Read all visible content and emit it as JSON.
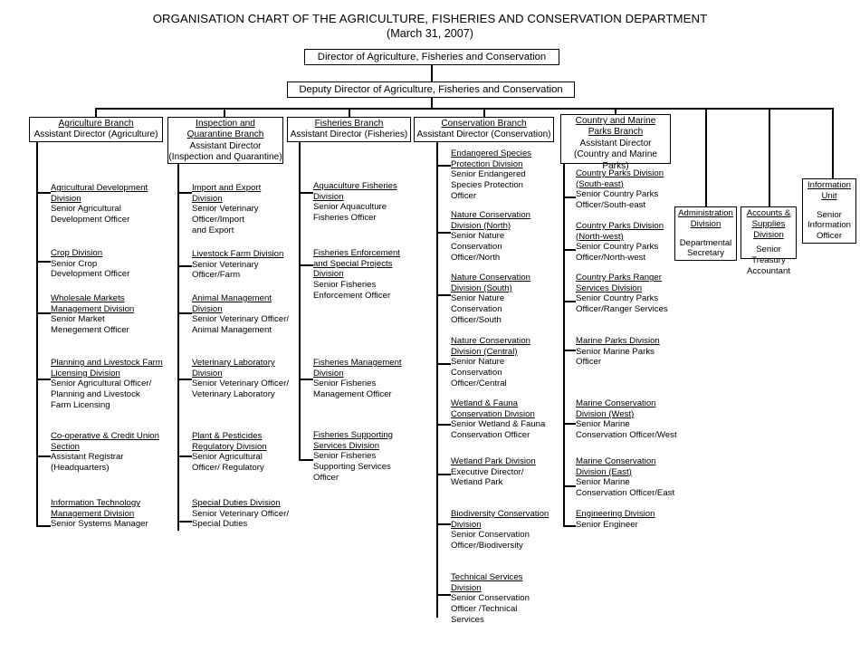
{
  "header": {
    "title": "ORGANISATION CHART OF THE AGRICULTURE, FISHERIES AND CONSERVATION DEPARTMENT",
    "date": "(March 31,  2007)"
  },
  "top": {
    "director": "Director of Agriculture, Fisheries and Conservation",
    "deputy_director": "Deputy Director of Agriculture, Fisheries and Conservation"
  },
  "branches": [
    {
      "id": "agriculture",
      "box": {
        "title_lines": [
          "Agriculture Branch"
        ],
        "role_lines": [
          "Assistant Director (Agriculture)"
        ]
      },
      "units": [
        {
          "head": [
            "Agricultural Development",
            "Division"
          ],
          "role": [
            "Senior Agricultural",
            "Development Officer"
          ]
        },
        {
          "head": [
            "Crop Division"
          ],
          "role": [
            "Senior Crop",
            "Development Officer"
          ]
        },
        {
          "head": [
            "Wholesale Markets",
            "Management Division"
          ],
          "role": [
            "Senior Market",
            "Menegement Officer"
          ]
        },
        {
          "head": [
            "Planning and Livestock Farm",
            "Licensing Division"
          ],
          "role": [
            "Senior Agricultural Officer/",
            "Planning and Livestock",
            "Farm Licensing"
          ]
        },
        {
          "head": [
            "Co-operative & Credit Union",
            "Section"
          ],
          "role": [
            "Assistant Registrar",
            "(Headquarters)"
          ]
        },
        {
          "head": [
            "Information Technology ",
            "Management Division"
          ],
          "role": [
            "Senior Systems Manager"
          ]
        }
      ]
    },
    {
      "id": "inspection",
      "box": {
        "title_lines": [
          "Inspection and",
          "Quarantine Branch"
        ],
        "role_lines": [
          "Assistant Director",
          "(Inspection and Quarantine)"
        ]
      },
      "units": [
        {
          "head": [
            "Import and Export ",
            "Division"
          ],
          "role": [
            "Senior Veterinary",
            "Officer/Import",
            "and Export"
          ]
        },
        {
          "head": [
            "Livestock Farm Division"
          ],
          "role": [
            "Senior Veterinary",
            "Officer/Farm"
          ]
        },
        {
          "head": [
            "Animal Management ",
            "Division"
          ],
          "role": [
            "Senior Veterinary Officer/",
            "Animal Management"
          ]
        },
        {
          "head": [
            "Veterinary Laboratory",
            "Division"
          ],
          "role": [
            "Senior Veterinary Officer/",
            "Veterinary Laboratory"
          ]
        },
        {
          "head": [
            "Plant & Pesticides",
            "Regulatory Division"
          ],
          "role": [
            "Senior Agricultural",
            "Officer/ Regulatory"
          ]
        },
        {
          "head": [
            "Special Duties Division"
          ],
          "role": [
            "Senior Veterinary Officer/",
            "Special Duties"
          ]
        }
      ]
    },
    {
      "id": "fisheries",
      "box": {
        "title_lines": [
          "Fisheries Branch"
        ],
        "role_lines": [
          "Assistant Director  (Fisheries)"
        ]
      },
      "units": [
        {
          "head": [
            "Aquaculture Fisheries",
            "Division"
          ],
          "role": [
            "Senior Aquaculture",
            "Fisheries Officer"
          ]
        },
        {
          "head": [
            "Fisheries Enforcement",
            "and Special Projects",
            "Division"
          ],
          "role": [
            "Senior Fisheries",
            "Enforcement Officer"
          ]
        },
        {
          "head": [
            "Fisheries Management",
            "Division"
          ],
          "role": [
            "Senior Fisheries",
            "Management Officer"
          ]
        },
        {
          "head": [
            "Fisheries Supporting ",
            "Services Division"
          ],
          "role": [
            "Senior Fisheries",
            "Supporting Services",
            "Officer"
          ]
        }
      ]
    },
    {
      "id": "conservation",
      "box": {
        "title_lines": [
          "Conservation Branch"
        ],
        "role_lines": [
          "Assistant Director (Conservation)"
        ]
      },
      "units": [
        {
          "head": [
            "Endangered Species",
            "Protection Division"
          ],
          "role": [
            "Senior Endangered",
            "Species Protection",
            "Officer"
          ]
        },
        {
          "head": [
            "Nature Conservation",
            "Division (North)"
          ],
          "role": [
            "Senior Nature",
            "Conservation",
            "Officer/North"
          ]
        },
        {
          "head": [
            "Nature Conservation",
            "Division (South)"
          ],
          "role": [
            "Senior Nature",
            "Conservation",
            "Officer/South"
          ]
        },
        {
          "head": [
            "Nature Conservation",
            "Division (Central)"
          ],
          "role": [
            "Senior Nature",
            "Conservation",
            "Officer/Central"
          ]
        },
        {
          "head": [
            "Wetland & Fauna",
            "Conservation Division"
          ],
          "role": [
            "Senior Wetland & Fauna",
            "Conservation Officer"
          ]
        },
        {
          "head": [
            "Wetland Park Division"
          ],
          "role": [
            "Executive Director/",
            "Wetland Park"
          ]
        },
        {
          "head": [
            "Biodiversity Conservation",
            "Division"
          ],
          "role": [
            "Senior Conservation",
            "Officer/Biodiversity"
          ]
        },
        {
          "head": [
            "Technical Services",
            "Division"
          ],
          "role": [
            "Senior Conservation",
            "Officer /Technical",
            "Services"
          ]
        }
      ]
    },
    {
      "id": "country-marine-parks",
      "box": {
        "title_lines": [
          "Country and Marine",
          "Parks Branch"
        ],
        "role_lines": [
          "Assistant Director",
          "(Country and Marine Parks)"
        ]
      },
      "units": [
        {
          "head": [
            "Country Parks Division",
            "(South-east)"
          ],
          "role": [
            "Senior Country Parks",
            "Officer/South-east"
          ]
        },
        {
          "head": [
            "Country Parks Division",
            "(North-west)"
          ],
          "role": [
            "Senior Country Parks",
            "Officer/North-west"
          ]
        },
        {
          "head": [
            "Country Parks Ranger",
            "Services Division"
          ],
          "role": [
            "Senior Country Parks",
            "Officer/Ranger Services"
          ]
        },
        {
          "head": [
            "Marine Parks Division"
          ],
          "role": [
            "Senior Marine Parks",
            "Officer"
          ]
        },
        {
          "head": [
            "Marine Conservation",
            "Division (West)"
          ],
          "role": [
            "Senior Marine",
            "Conservation Officer/West"
          ]
        },
        {
          "head": [
            "Marine Conservation",
            "Division (East)"
          ],
          "role": [
            "Senior Marine",
            "Conservation Officer/East"
          ]
        },
        {
          "head": [
            "Engineering Division"
          ],
          "role": [
            "Senior Engineer"
          ]
        }
      ]
    }
  ],
  "support_units": [
    {
      "id": "administration",
      "title_lines": [
        "Administration ",
        "Division"
      ],
      "role_lines": [
        "Departmental",
        "Secretary"
      ]
    },
    {
      "id": "accounts-supplies",
      "title_lines": [
        "Accounts & ",
        "Supplies ",
        "Division"
      ],
      "role_lines": [
        "Senior",
        "Treasury",
        "Accountant"
      ]
    },
    {
      "id": "information-unit",
      "title_lines": [
        "Information ",
        "Unit"
      ],
      "role_lines": [
        "Senior",
        "Information",
        "Officer"
      ]
    }
  ],
  "colors": {
    "line": "#000000",
    "background": "#ffffff",
    "text": "#000000"
  }
}
